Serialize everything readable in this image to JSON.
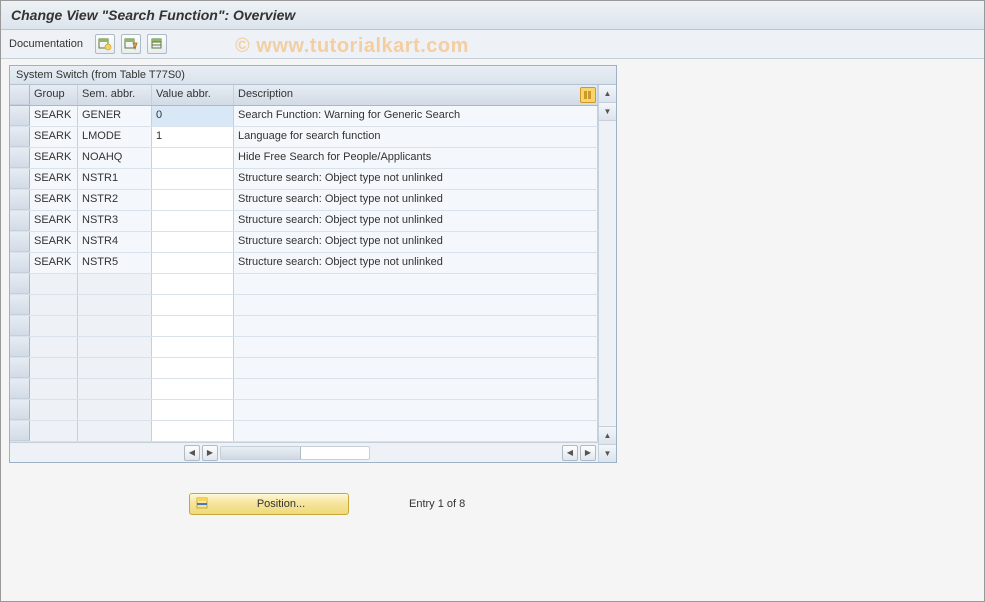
{
  "title": "Change View \"Search Function\": Overview",
  "toolbar": {
    "documentation_label": "Documentation",
    "btn1_name": "new-entries-icon",
    "btn2_name": "copy-entry-icon",
    "btn3_name": "delete-entry-icon"
  },
  "watermark": "© www.tutorialkart.com",
  "panel": {
    "title": "System Switch (from Table T77S0)",
    "columns": {
      "group": "Group",
      "sem": "Sem. abbr.",
      "val": "Value abbr.",
      "desc": "Description"
    },
    "rows": [
      {
        "group": "SEARK",
        "sem": "GENER",
        "val": "0",
        "desc": "Search Function: Warning for Generic Search",
        "val_hl": true
      },
      {
        "group": "SEARK",
        "sem": "LMODE",
        "val": "1",
        "desc": "Language for search function"
      },
      {
        "group": "SEARK",
        "sem": "NOAHQ",
        "val": "",
        "desc": "Hide Free Search for People/Applicants"
      },
      {
        "group": "SEARK",
        "sem": "NSTR1",
        "val": "",
        "desc": "Structure search: Object type not unlinked"
      },
      {
        "group": "SEARK",
        "sem": "NSTR2",
        "val": "",
        "desc": "Structure search: Object type not unlinked"
      },
      {
        "group": "SEARK",
        "sem": "NSTR3",
        "val": "",
        "desc": "Structure search: Object type not unlinked"
      },
      {
        "group": "SEARK",
        "sem": "NSTR4",
        "val": "",
        "desc": "Structure search: Object type not unlinked"
      },
      {
        "group": "SEARK",
        "sem": "NSTR5",
        "val": "",
        "desc": "Structure search: Object type not unlinked"
      }
    ],
    "empty_rows": 8
  },
  "footer": {
    "position_label": "Position...",
    "entry_label": "Entry 1 of 8"
  }
}
